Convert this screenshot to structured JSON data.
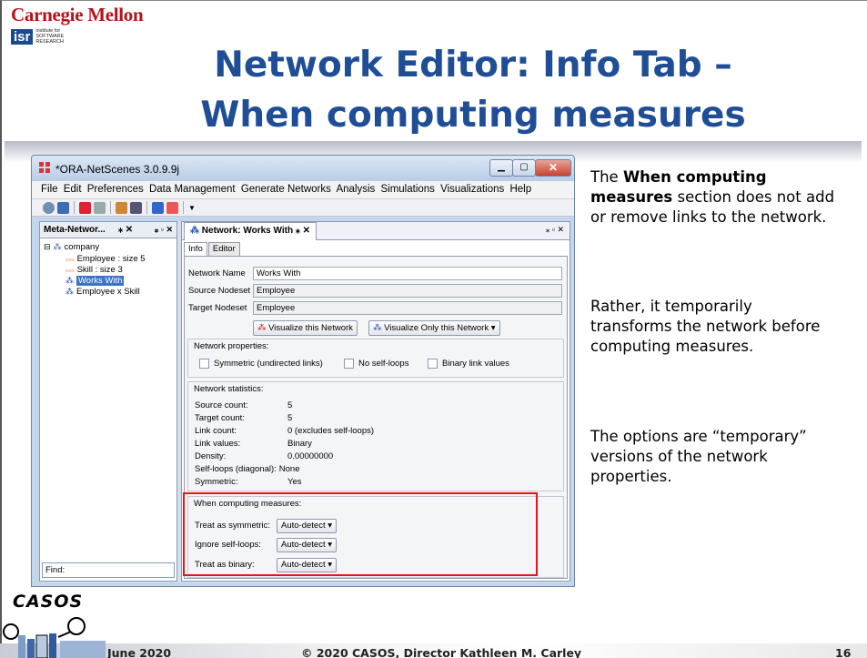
{
  "slide": {
    "org": "Carnegie Mellon",
    "isr_logo": "isr",
    "isr_text": "institute for SOFTWARE RESEARCH",
    "title_line1": "Network Editor: Info Tab –",
    "title_line2": "When computing measures",
    "casos_logo": "CASOS",
    "footer_date": "June 2020",
    "footer_copyright": "© 2020 CASOS, Director Kathleen M. Carley",
    "page_number": "16",
    "notes": {
      "p1_lead": "The ",
      "p1_bold": "When computing measures",
      "p1_rest": " section does not add or remove links to the network.",
      "p2": "Rather, it temporarily transforms the network before computing measures.",
      "p3": "The options are “temporary” versions of the network properties."
    }
  },
  "app": {
    "window_title": "*ORA-NetScenes 3.0.9.9j",
    "menu": [
      "File",
      "Edit",
      "Preferences",
      "Data Management",
      "Generate Networks",
      "Analysis",
      "Simulations",
      "Visualizations",
      "Help"
    ],
    "left_panel_tab": "Meta-Networ...",
    "tree": {
      "root": "company",
      "items": [
        "Employee : size 5",
        "Skill : size 3",
        "Works With",
        "Employee x Skill"
      ]
    },
    "find_label": "Find:",
    "right_tab": "Network: Works With",
    "subtabs": [
      "Info",
      "Editor"
    ],
    "fields": {
      "network_name_label": "Network Name",
      "network_name_value": "Works With",
      "source_label": "Source Nodeset",
      "source_value": "Employee",
      "target_label": "Target Nodeset",
      "target_value": "Employee"
    },
    "buttons": {
      "visualize": "Visualize this Network",
      "visualize_only": "Visualize Only this Network"
    },
    "properties": {
      "title": "Network properties:",
      "symmetric": "Symmetric (undirected links)",
      "no_self_loops": "No self-loops",
      "binary": "Binary link values"
    },
    "statistics": {
      "title": "Network statistics:",
      "rows": [
        {
          "label": "Source count:",
          "value": "5"
        },
        {
          "label": "Target count:",
          "value": "5"
        },
        {
          "label": "Link count:",
          "value": "0 (excludes self-loops)"
        },
        {
          "label": "Link values:",
          "value": "Binary"
        },
        {
          "label": "Density:",
          "value": "0.00000000"
        },
        {
          "label": "Self-loops (diagonal):",
          "value": "None"
        },
        {
          "label": "Symmetric:",
          "value": "Yes"
        }
      ]
    },
    "measures": {
      "title": "When computing measures:",
      "rows": [
        {
          "label": "Treat as symmetric:",
          "value": "Auto-detect"
        },
        {
          "label": "Ignore self-loops:",
          "value": "Auto-detect"
        },
        {
          "label": "Treat as binary:",
          "value": "Auto-detect"
        }
      ]
    }
  }
}
